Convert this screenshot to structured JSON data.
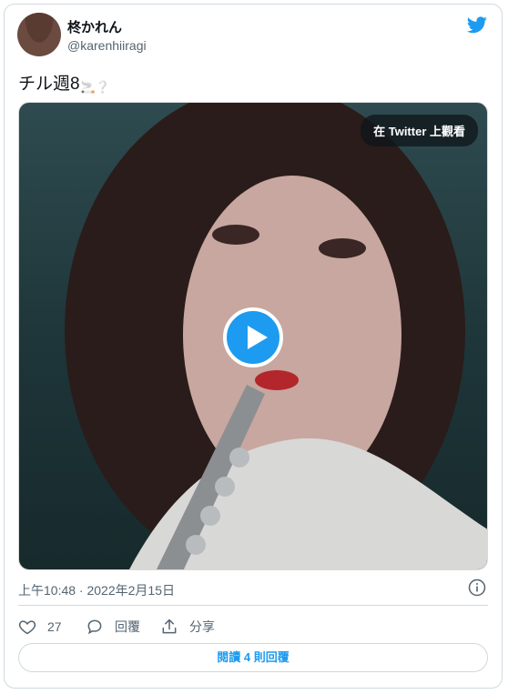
{
  "author": {
    "display_name": "柊かれん",
    "handle": "@karenhiiragi"
  },
  "tweet": {
    "text": "チル週8",
    "emoji": "🚬❔"
  },
  "media": {
    "view_on_twitter_label": "在 Twitter 上觀看"
  },
  "meta": {
    "timestamp": "上午10:48 · 2022年2月15日"
  },
  "actions": {
    "like_count": "27",
    "reply_label": "回覆",
    "share_label": "分享"
  },
  "read_replies_label": "閱讀 4 則回覆",
  "colors": {
    "accent": "#1d9bf0",
    "text": "#0f1419",
    "secondary_text": "#536471",
    "border": "#cfd9de"
  },
  "icons": [
    "twitter-bird-icon",
    "play-icon",
    "info-icon",
    "heart-icon",
    "reply-bubble-icon",
    "share-icon"
  ]
}
